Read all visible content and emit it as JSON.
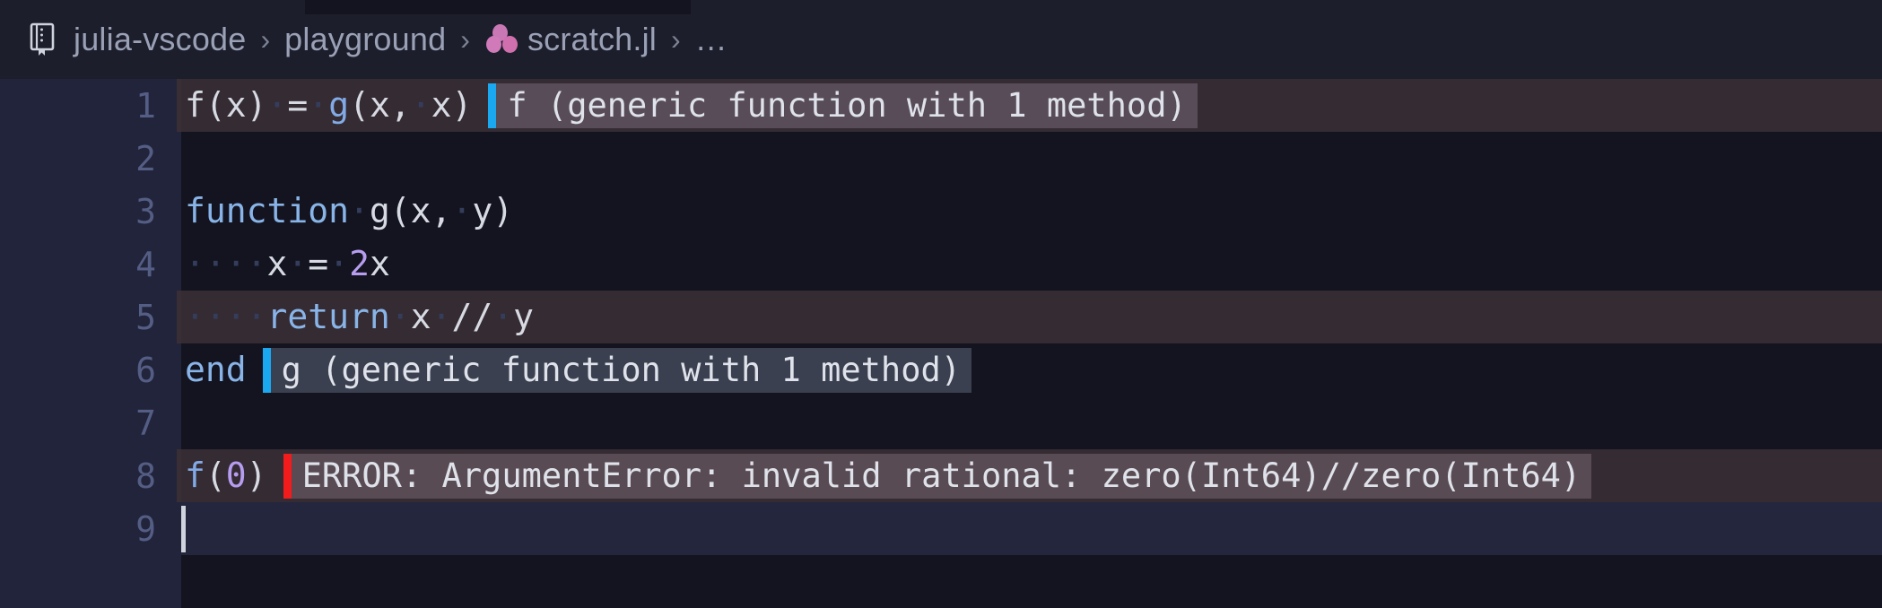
{
  "window": {
    "background": "#13141f"
  },
  "breadcrumb": {
    "icon": "notebook-icon",
    "items": [
      {
        "label": "julia-vscode",
        "type": "folder"
      },
      {
        "label": "playground",
        "type": "folder"
      },
      {
        "label": "scratch.jl",
        "type": "file",
        "icon": "julia-dots-icon"
      },
      {
        "label": "…",
        "type": "overflow"
      }
    ],
    "separator": "›",
    "text_color": "#9aa0b5"
  },
  "editor": {
    "language": "julia",
    "file": "scratch.jl",
    "render_whitespace": true,
    "whitespace_glyph": "·",
    "colors": {
      "background": "#13141f",
      "gutter_background": "#21243a",
      "line_number": "#545d84",
      "modified_line_background": "#352b33",
      "active_line_background": "#23263d",
      "keyword": "#89b4e8",
      "number": "#b79df0",
      "plain_text": "#d7dae3",
      "whitespace_dot": "#353d5c",
      "result_bar_ok": "#1aa9f0",
      "result_bar_error": "#f21c1c",
      "result_chip_light": "#574c58",
      "result_chip_dark": "#3a4050",
      "caret": "#cfd3dd"
    },
    "lines": [
      {
        "number": "1",
        "modified": true,
        "active": false,
        "tokens": [
          {
            "text": "f(x)",
            "kind": "plain"
          },
          {
            "text": "·",
            "kind": "ws"
          },
          {
            "text": "=",
            "kind": "plain"
          },
          {
            "text": "·",
            "kind": "ws"
          },
          {
            "text": "g",
            "kind": "fn"
          },
          {
            "text": "(x,",
            "kind": "plain"
          },
          {
            "text": "·",
            "kind": "ws"
          },
          {
            "text": "x)",
            "kind": "plain"
          }
        ],
        "result": {
          "type": "value",
          "bar": "ok",
          "chip": "light",
          "text": "f (generic function with 1 method)"
        }
      },
      {
        "number": "2",
        "modified": false,
        "active": false,
        "tokens": [],
        "result": null
      },
      {
        "number": "3",
        "modified": false,
        "active": false,
        "tokens": [
          {
            "text": "function",
            "kind": "kw"
          },
          {
            "text": "·",
            "kind": "ws"
          },
          {
            "text": "g(x,",
            "kind": "plain"
          },
          {
            "text": "·",
            "kind": "ws"
          },
          {
            "text": "y)",
            "kind": "plain"
          }
        ],
        "result": null
      },
      {
        "number": "4",
        "modified": false,
        "active": false,
        "tokens": [
          {
            "text": "····",
            "kind": "ws"
          },
          {
            "text": "x",
            "kind": "plain"
          },
          {
            "text": "·",
            "kind": "ws"
          },
          {
            "text": "=",
            "kind": "plain"
          },
          {
            "text": "·",
            "kind": "ws"
          },
          {
            "text": "2",
            "kind": "num"
          },
          {
            "text": "x",
            "kind": "plain"
          }
        ],
        "result": null
      },
      {
        "number": "5",
        "modified": true,
        "active": false,
        "tokens": [
          {
            "text": "····",
            "kind": "ws"
          },
          {
            "text": "return",
            "kind": "kw"
          },
          {
            "text": "·",
            "kind": "ws"
          },
          {
            "text": "x",
            "kind": "plain"
          },
          {
            "text": "·",
            "kind": "ws"
          },
          {
            "text": "//",
            "kind": "plain"
          },
          {
            "text": "·",
            "kind": "ws"
          },
          {
            "text": "y",
            "kind": "plain"
          }
        ],
        "result": null
      },
      {
        "number": "6",
        "modified": false,
        "active": false,
        "tokens": [
          {
            "text": "end",
            "kind": "kw"
          }
        ],
        "result": {
          "type": "value",
          "bar": "ok",
          "chip": "dark",
          "text": "g (generic function with 1 method)"
        }
      },
      {
        "number": "7",
        "modified": false,
        "active": false,
        "tokens": [],
        "result": null
      },
      {
        "number": "8",
        "modified": true,
        "active": false,
        "tokens": [
          {
            "text": "f",
            "kind": "fn"
          },
          {
            "text": "(",
            "kind": "plain"
          },
          {
            "text": "0",
            "kind": "num"
          },
          {
            "text": ")",
            "kind": "plain"
          }
        ],
        "result": {
          "type": "error",
          "bar": "error",
          "chip": "err",
          "text": "ERROR: ArgumentError: invalid rational: zero(Int64)//zero(Int64)"
        }
      },
      {
        "number": "9",
        "modified": false,
        "active": true,
        "caret": true,
        "tokens": [],
        "result": null
      }
    ]
  }
}
